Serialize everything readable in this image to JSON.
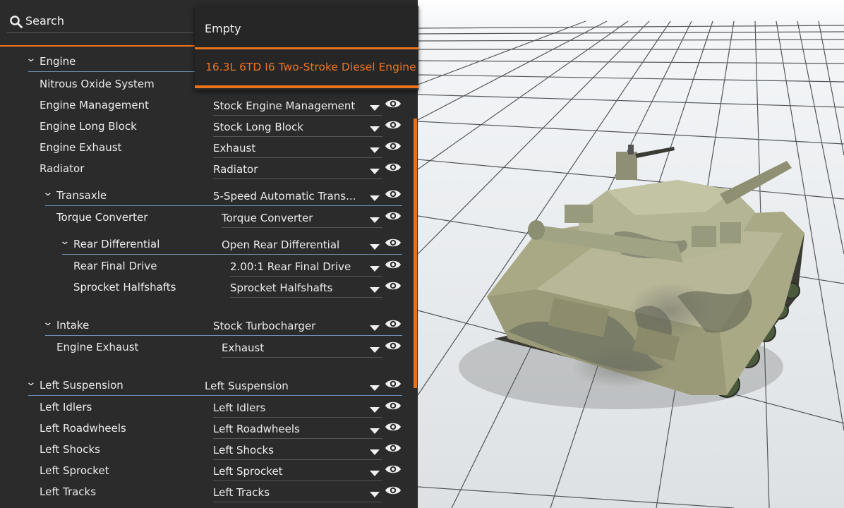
{
  "search": {
    "label": "Search"
  },
  "dropdown": {
    "options": [
      "Empty",
      "16.3L 6TD I6 Two-Stroke Diesel Engine"
    ]
  },
  "rows": [
    {
      "label": "Engine",
      "value": ""
    },
    {
      "label": "Nitrous Oxide System",
      "value": ""
    },
    {
      "label": "Engine Management",
      "value": "Stock Engine Management"
    },
    {
      "label": "Engine Long Block",
      "value": "Stock Long Block"
    },
    {
      "label": "Engine Exhaust",
      "value": "Exhaust"
    },
    {
      "label": "Radiator",
      "value": "Radiator"
    },
    {
      "label": "Transaxle",
      "value": "5-Speed Automatic Trans..."
    },
    {
      "label": "Torque Converter",
      "value": "Torque Converter"
    },
    {
      "label": "Rear Differential",
      "value": "Open Rear Differential"
    },
    {
      "label": "Rear Final Drive",
      "value": "2.00:1 Rear Final Drive"
    },
    {
      "label": "Sprocket Halfshafts",
      "value": "Sprocket Halfshafts"
    },
    {
      "label": "Intake",
      "value": "Stock Turbocharger"
    },
    {
      "label": "Engine Exhaust",
      "value": "Exhaust"
    },
    {
      "label": "Left Suspension",
      "value": "Left Suspension"
    },
    {
      "label": "Left Idlers",
      "value": "Left Idlers"
    },
    {
      "label": "Left Roadwheels",
      "value": "Left Roadwheels"
    },
    {
      "label": "Left Shocks",
      "value": "Left Shocks"
    },
    {
      "label": "Left Sprocket",
      "value": "Left Sprocket"
    },
    {
      "label": "Left Tracks",
      "value": "Left Tracks"
    }
  ],
  "colors": {
    "accent": "#e8731c",
    "panel": "#2b2b2b",
    "header_line": "#6a8fb3"
  },
  "icons": [
    "search-icon",
    "chevron-down-icon",
    "eye-icon",
    "dropdown-caret-icon"
  ]
}
